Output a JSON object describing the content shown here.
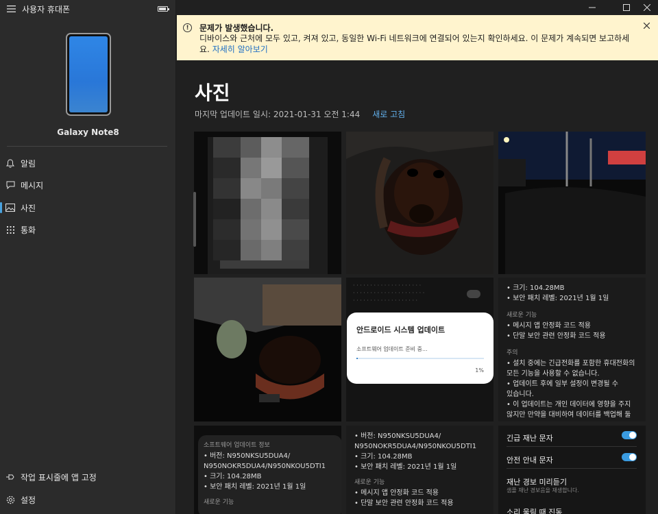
{
  "sidebar": {
    "app_title": "사용자 휴대폰",
    "device_name": "Galaxy Note8",
    "nav": [
      {
        "label": "알림"
      },
      {
        "label": "메시지"
      },
      {
        "label": "사진"
      },
      {
        "label": "통화"
      }
    ],
    "pin_label": "작업 표시줄에 앱 고정",
    "settings_label": "설정"
  },
  "banner": {
    "title": "문제가 발생했습니다.",
    "body": "디바이스와 근처에 모두 있고, 켜져 있고, 동일한 Wi-Fi 네트워크에 연결되어 있는지 확인하세요. 이 문제가 계속되면 보고하세요.",
    "link": "자세히 알아보기"
  },
  "page": {
    "title": "사진",
    "last_update": "마지막 업데이트 일시: 2021-01-31 오전 1:44",
    "refresh": "새로 고침"
  },
  "tiles": {
    "t5": {
      "dialog_title": "안드로이드 시스템 업데이트",
      "dialog_sub": "소프트웨어 업데이트 준비 중...",
      "dialog_pct": "1%",
      "progress": 0.01
    },
    "t6": {
      "lines": [
        "• 크기: 104.28MB",
        "• 보안 패치 레벨: 2021년 1월 1일"
      ],
      "new_head": "새로운 기능",
      "new_lines": [
        "• 메시지 앱 안정화 코드 적용",
        "• 단말 보안 관련 안정화 코드 적용"
      ],
      "note_head": "주의",
      "note_lines": [
        "• 설치 중에는 긴급전화를 포함한 휴대전화의",
        "  모든 기능을 사용할 수 없습니다.",
        "• 업데이트 후에 일부 설정이 변경될 수",
        "  있습니다.",
        "• 이 업데이트는 개인 데이터에 영향을 주지",
        "  않지만 만약을 대비하여 데이터를 백업해 둘"
      ]
    },
    "t7": {
      "head": "소프트웨어 업데이트 정보",
      "lines": [
        "• 버전: N950NKSU5DUA4/",
        "  N950NOKR5DUA4/N950NKOU5DTI1",
        "• 크기: 104.28MB",
        "• 보안 패치 레벨: 2021년 1월 1일"
      ],
      "new_head": "새로운 기능"
    },
    "t8": {
      "lines": [
        "• 버전: N950NKSU5DUA4/",
        "  N950NOKR5DUA4/N950NKOU5DTI1",
        "• 크기: 104.28MB",
        "• 보안 패치 레벨: 2021년 1월 1일"
      ],
      "new_head": "새로운 기능",
      "new_lines": [
        "• 메시지 앱 안정화 코드 적용",
        "• 단말 보안 관련 안정화 코드 적용"
      ]
    },
    "t9": {
      "row1": "긴급 재난 문자",
      "row2": "안전 안내 문자",
      "row3": "재난 경보 미리듣기",
      "row3_sub": "샘플 재난 경보음을 재생합니다.",
      "row4": "소리 울림 때 진동"
    }
  }
}
